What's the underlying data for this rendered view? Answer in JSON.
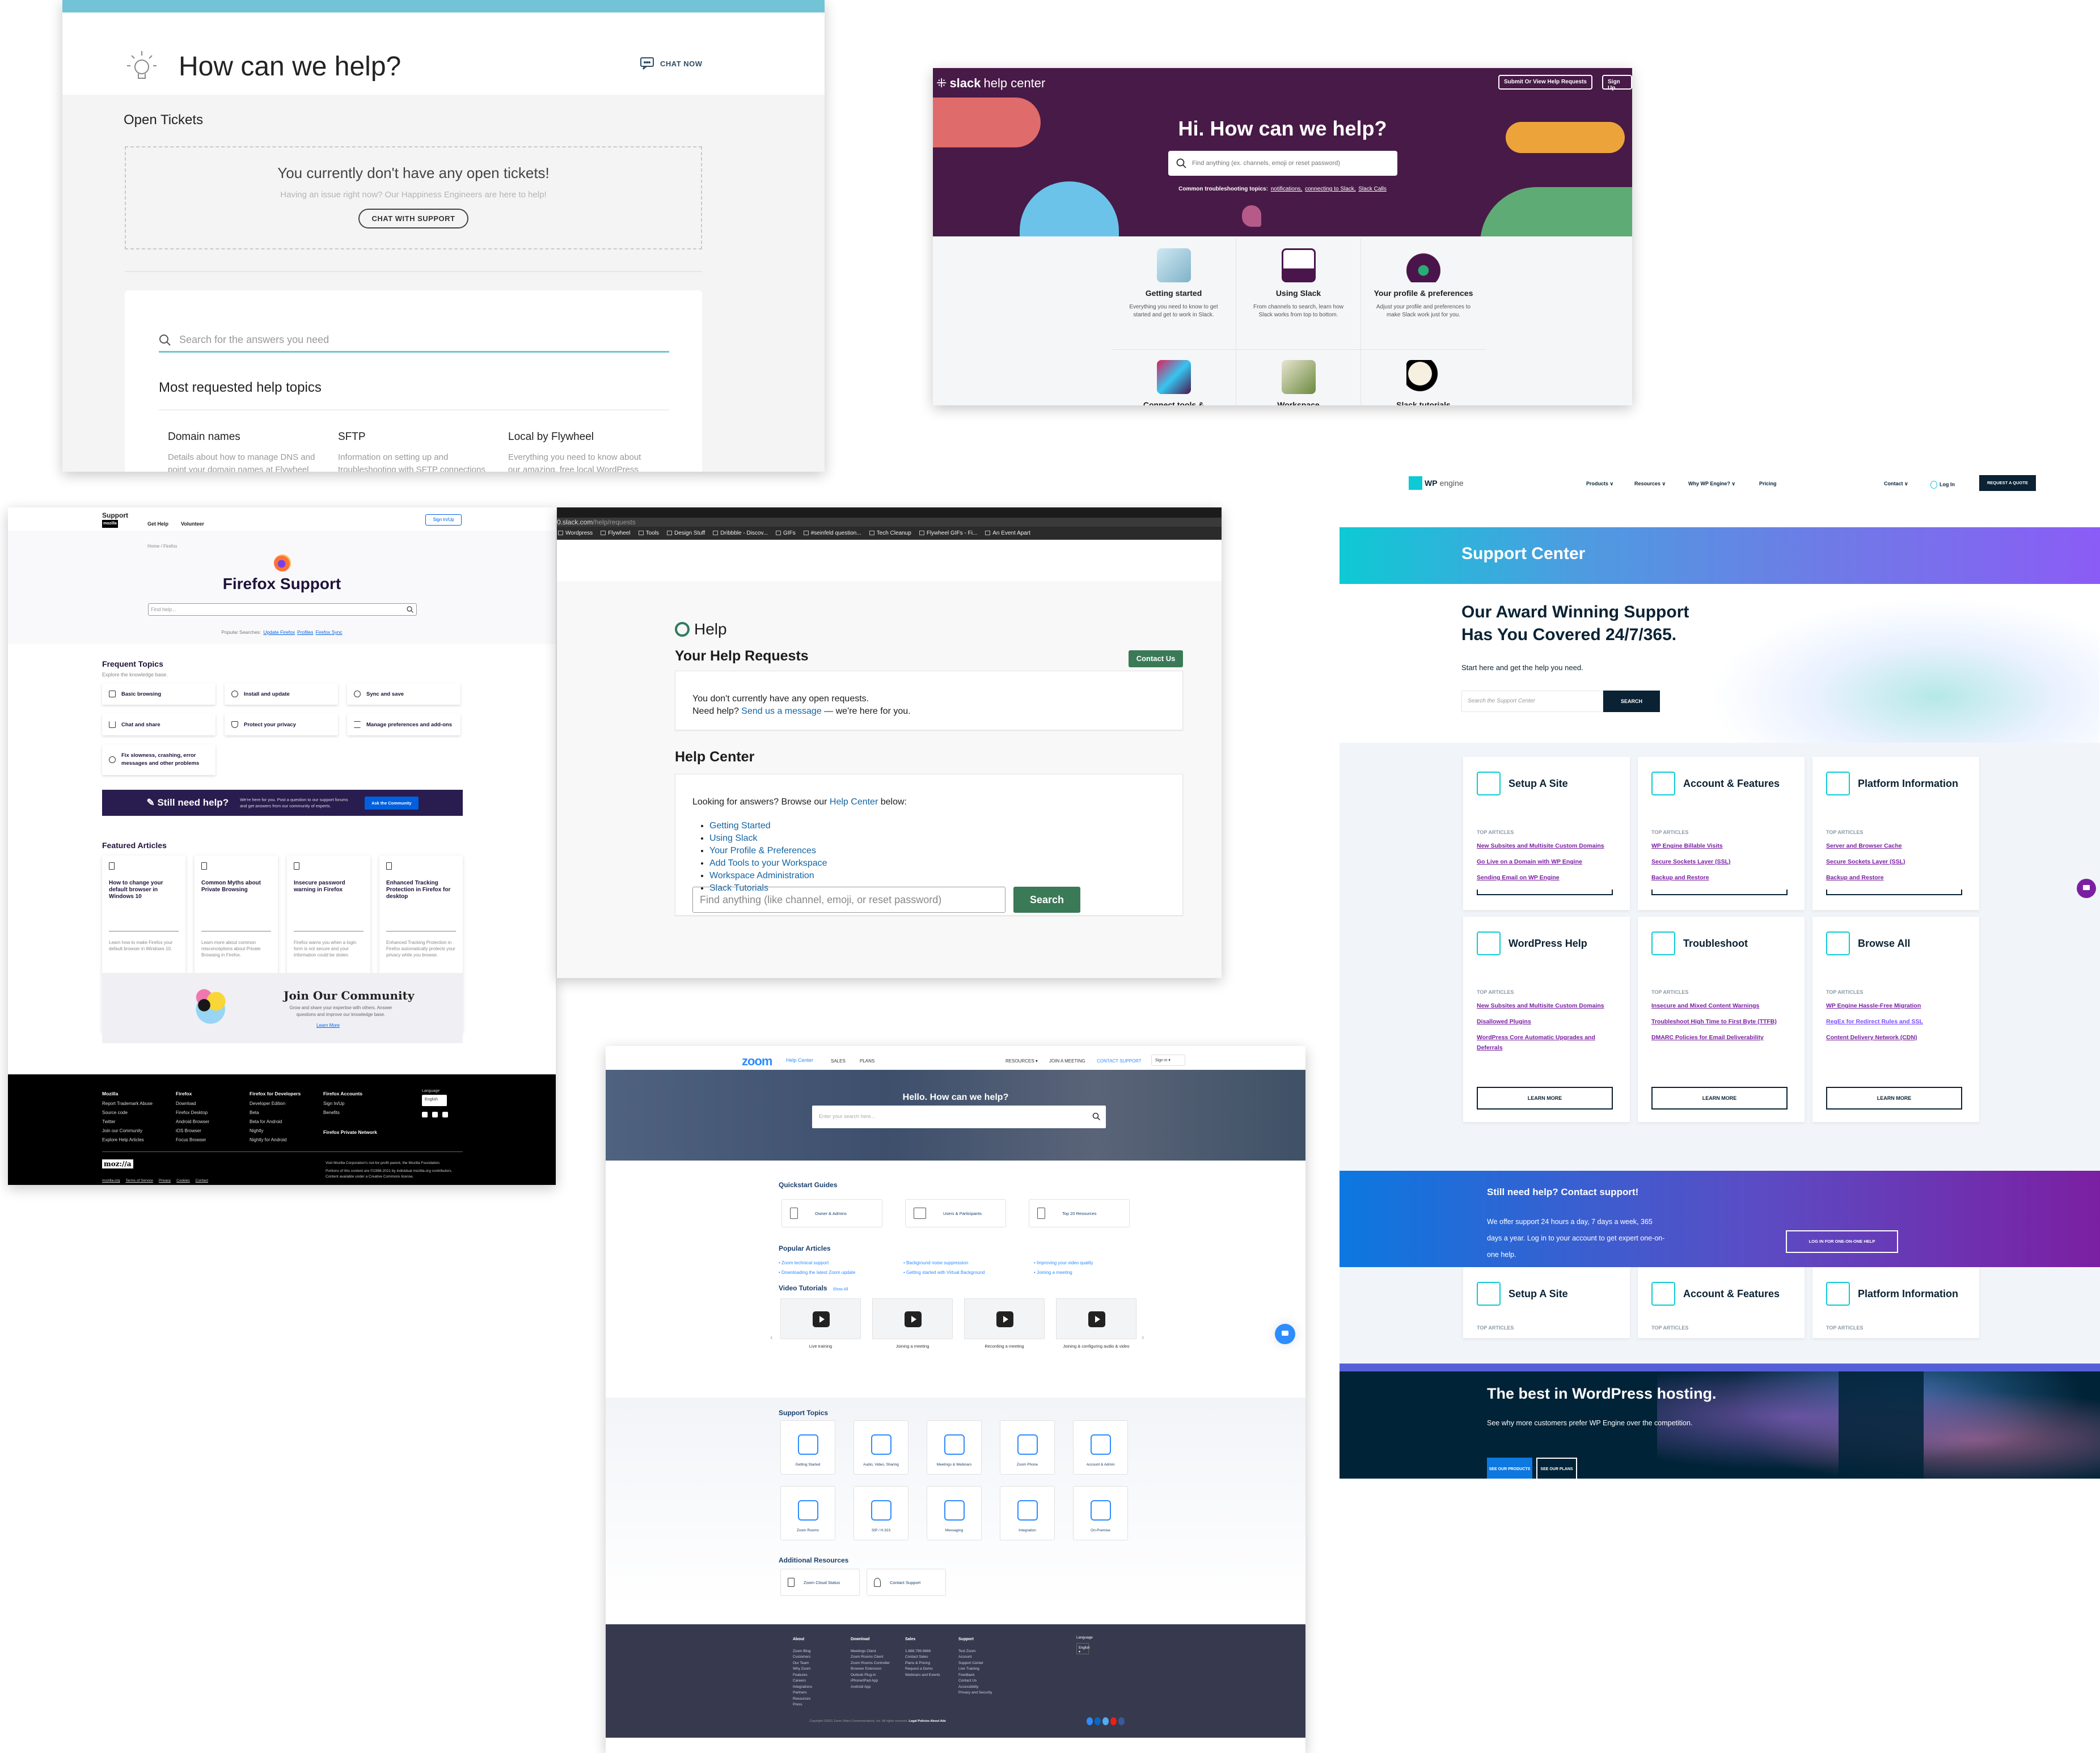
{
  "flywheel": {
    "title": "How can we help?",
    "chat_now": "CHAT NOW",
    "open_tickets_heading": "Open Tickets",
    "no_tickets": "You currently don't have any open tickets!",
    "no_tickets_sub": "Having an issue right now? Our Happiness Engineers are here to help!",
    "chat_with_support": "CHAT WITH SUPPORT",
    "search_placeholder": "Search for the answers you need",
    "most_requested": "Most requested help topics",
    "topics": [
      {
        "title": "Domain names",
        "desc": "Details about how to manage DNS and point your domain names at Flywheel"
      },
      {
        "title": "SFTP",
        "desc": "Information on setting up and troubleshooting with SFTP connections"
      },
      {
        "title": "Local by Flywheel",
        "desc": "Everything you need to know about our amazing, free local WordPress"
      }
    ]
  },
  "slack_help": {
    "logo_bold": "slack",
    "logo_rest": "help center",
    "submit_button": "Submit Or View Help Requests",
    "signup_button": "Sign Up",
    "title": "Hi. How can we help?",
    "search_placeholder": "Find anything (ex. channels, emoji or reset password)",
    "common_label": "Common troubleshooting topics:",
    "common_links": [
      "notifications,",
      "connecting to Slack,",
      "Slack Calls"
    ],
    "categories": [
      {
        "title": "Getting started",
        "desc": "Everything you need to know to get started and get to work in Slack."
      },
      {
        "title": "Using Slack",
        "desc": "From channels to search, learn how Slack works from top to bottom."
      },
      {
        "title": "Your profile & preferences",
        "desc": "Adjust your profile and preferences to make Slack work just for you."
      },
      {
        "title": "Connect tools &",
        "desc": ""
      },
      {
        "title": "Workspace",
        "desc": ""
      },
      {
        "title": "Slack tutorials",
        "desc": ""
      }
    ],
    "colors": {
      "bg": "#481a47",
      "red": "#e06b6b",
      "orange": "#eca43a",
      "blue": "#6bc3ea",
      "green": "#5fab75",
      "pink": "#b65a8a"
    }
  },
  "firefox": {
    "brand": "Support",
    "brand_sub": "mozilla",
    "nav": [
      "Get Help",
      "Volunteer"
    ],
    "sign_in": "Sign In/Up",
    "breadcrumb": "Home / Firefox",
    "title": "Firefox Support",
    "search_placeholder": "Find help...",
    "popular_label": "Popular Searches:",
    "popular_links": [
      "Update Firefox",
      "Profiles",
      "Firefox Sync"
    ],
    "frequent_heading": "Frequent Topics",
    "frequent_sub": "Explore the knowledge base.",
    "topics": [
      "Basic browsing",
      "Install and update",
      "Sync and save",
      "Chat and share",
      "Protect your privacy",
      "Manage preferences and add-ons",
      "Fix slowness, crashing, error messages and other problems"
    ],
    "still_title": "Still need help?",
    "still_desc": "We're here for you. Post a question to our support forums and get answers from our community of experts.",
    "still_button": "Ask the Community",
    "featured_heading": "Featured Articles",
    "articles": [
      {
        "title": "How to change your default browser in Windows 10",
        "desc": "Learn how to make Firefox your default browser in Windows 10."
      },
      {
        "title": "Common Myths about Private Browsing",
        "desc": "Learn more about common misconceptions about Private Browsing in Firefox."
      },
      {
        "title": "Insecure password warning in Firefox",
        "desc": "Firefox warns you when a login form is not secure and your information could be stolen."
      },
      {
        "title": "Enhanced Tracking Protection in Firefox for desktop",
        "desc": "Enhanced Tracking Protection in Firefox automatically protects your privacy while you browse."
      }
    ],
    "community_title": "Join Our Community",
    "community_desc": "Grow and share your expertise with others. Answer questions and improve our knowledge base.",
    "community_link": "Learn More",
    "footer": {
      "columns": [
        {
          "title": "Mozilla",
          "links": [
            "Report Trademark Abuse",
            "Source code",
            "Twitter",
            "Join our Community",
            "Explore Help Articles"
          ]
        },
        {
          "title": "Firefox",
          "links": [
            "Download",
            "Firefox Desktop",
            "Android Browser",
            "iOS Browser",
            "Focus Browser"
          ]
        },
        {
          "title": "Firefox for Developers",
          "links": [
            "Developer Edition",
            "Beta",
            "Beta for Android",
            "Nightly",
            "Nightly for Android"
          ]
        },
        {
          "title": "Firefox Accounts",
          "links": [
            "Sign In/Up",
            "Benefits"
          ]
        }
      ],
      "private_network": "Firefox Private Network",
      "language_label": "Language",
      "language_value": "English",
      "logo": "moz://a",
      "legal": [
        "mozilla.org",
        "Terms of Service",
        "Privacy",
        "Cookies",
        "Contact"
      ],
      "note1": "Visit Mozilla Corporation's not-for-profit parent, the Mozilla Foundation.",
      "note2": "Portions of this content are ©1998-2021 by individual mozilla.org contributors. Content available under a Creative Commons license."
    }
  },
  "slack_requests": {
    "url_host": "0.slack.com",
    "url_path": "/help/requests",
    "bookmarks": [
      "Wordpress",
      "Flywheel",
      "Tools",
      "Design Stuff",
      "Dribbble - Discov...",
      "GIFs",
      "#seinfeld question...",
      "Tech Cleanup",
      "Flywheel GIFs - Fi...",
      "An Event Apart"
    ],
    "help_title": "Help",
    "requests_heading": "Your Help Requests",
    "contact_us": "Contact Us",
    "no_requests": "You don't currently have any open requests.",
    "need_help": "Need help?",
    "send_message": "Send us a message",
    "here_for_you": "— we're here for you.",
    "help_center_heading": "Help Center",
    "looking": "Looking for answers? Browse our",
    "help_center_link": "Help Center",
    "below": "below:",
    "links": [
      "Getting Started",
      "Using Slack",
      "Your Profile & Preferences",
      "Add Tools to your Workspace",
      "Workspace Administration",
      "Slack Tutorials"
    ],
    "search_placeholder": "Find anything (like channel, emoji, or reset password)",
    "search_button": "Search"
  },
  "zoom": {
    "logo": "zoom",
    "help_center": "Help Center",
    "nav_left": [
      "SALES",
      "PLANS"
    ],
    "nav_right": [
      "RESOURCES ▾",
      "JOIN A MEETING",
      "CONTACT SUPPORT"
    ],
    "sign_in": "Sign in  ▾",
    "hero_title": "Hello. How can we help?",
    "search_placeholder": "Enter your search here...",
    "quickstart_heading": "Quickstart Guides",
    "quickstart": [
      "Owner & Admins",
      "Users & Participants",
      "Top 20 Resources"
    ],
    "popular_heading": "Popular Articles",
    "popular": [
      "Zoom technical support",
      "Background noise suppression",
      "Improving your video quality",
      "Downloading the latest Zoom update",
      "Getting started with Virtual Background",
      "Joining a meeting"
    ],
    "video_heading": "Video Tutorials",
    "show_all": "Show All",
    "videos": [
      "Live training",
      "Joining a meeting",
      "Recording a meeting",
      "Joining & configuring audio & video"
    ],
    "support_heading": "Support Topics",
    "support_topics": [
      "Getting Started",
      "Audio, Video, Sharing",
      "Meetings & Webinars",
      "Zoom Phone",
      "Account & Admin",
      "Zoom Rooms",
      "SIP / H.323",
      "Messaging",
      "Integration",
      "On-Premise"
    ],
    "additional_heading": "Additional Resources",
    "additional": [
      "Zoom Cloud Status",
      "Contact Support"
    ],
    "footer": {
      "columns": [
        {
          "title": "About",
          "links": [
            "Zoom Blog",
            "Customers",
            "Our Team",
            "Why Zoom",
            "Features",
            "Careers",
            "Integrations",
            "Partners",
            "Resources",
            "Press"
          ]
        },
        {
          "title": "Download",
          "links": [
            "Meetings Client",
            "Zoom Rooms Client",
            "Zoom Rooms Controller",
            "Browser Extension",
            "Outlook Plug-in",
            "iPhone/iPad App",
            "Android App"
          ]
        },
        {
          "title": "Sales",
          "links": [
            "1.888.799.9666",
            "Contact Sales",
            "Plans & Pricing",
            "Request a Demo",
            "Webinars and Events"
          ]
        },
        {
          "title": "Support",
          "links": [
            "Test Zoom",
            "Account",
            "Support Center",
            "Live Training",
            "Feedback",
            "Contact Us",
            "Accessibility",
            "Privacy and Security"
          ]
        }
      ],
      "language_label": "Language",
      "language_value": "English ▾",
      "copyright": "Copyright ©2021 Zoom Video Communications, Inc. All rights reserved.",
      "legal": "Legal Policies About Ads",
      "social_colors": [
        "#2d8cff",
        "#0a66c2",
        "#55acee",
        "#e62117",
        "#3b5998"
      ]
    }
  },
  "wpengine": {
    "logo_bold": "WP",
    "logo_rest": "engine",
    "nav": [
      "Products ∨",
      "Resources ∨",
      "Why WP Engine? ∨",
      "Pricing"
    ],
    "contact": "Contact ∨",
    "login": "Log In",
    "quote": "REQUEST A QUOTE",
    "band_title": "Support Center",
    "headline_1": "Our Award Winning Support",
    "headline_2": "Has You Covered 24/7/365.",
    "subline": "Start here and get the help you need.",
    "search_placeholder": "Search the Support Center",
    "search_button": "SEARCH",
    "top_articles_label": "TOP ARTICLES",
    "learn_more": "LEARN MORE",
    "cards": [
      {
        "title": "Setup A Site",
        "links": [
          "New Subsites and Multisite Custom Domains",
          "Go Live on a Domain with WP Engine",
          "Sending Email on WP Engine"
        ]
      },
      {
        "title": "Account & Features",
        "links": [
          "WP Engine Billable Visits",
          "Secure Sockets Layer (SSL)",
          "Backup and Restore"
        ]
      },
      {
        "title": "Platform Information",
        "links": [
          "Server and Browser Cache",
          "Secure Sockets Layer (SSL)",
          "Backup and Restore"
        ]
      },
      {
        "title": "WordPress Help",
        "links": [
          "New Subsites and Multisite Custom Domains",
          "Disallowed Plugins",
          "WordPress Core Automatic Upgrades and Deferrals"
        ]
      },
      {
        "title": "Troubleshoot",
        "links": [
          "Insecure and Mixed Content Warnings",
          "Troubleshoot High Time to First Byte (TTFB)",
          "DMARC Policies for Email Deliverability"
        ]
      },
      {
        "title": "Browse All",
        "links": [
          "WP Engine Hassle-Free Migration",
          "RegEx for Redirect Rules and SSL",
          "Content Delivery Network (CDN)"
        ]
      }
    ],
    "help_title": "Still need help? Contact support!",
    "help_desc": "We offer support 24 hours a day, 7 days a week, 365 days a year. Log in to your account to get expert one-on-one help.",
    "help_button": "LOG IN FOR ONE-ON-ONE HELP",
    "best_title": "The best in WordPress hosting.",
    "best_desc": "See why more customers prefer WP Engine over the competition.",
    "products_button": "SEE OUR PRODUCTS",
    "plans_button": "SEE OUR PLANS",
    "colors": {
      "navy": "#0a2233",
      "teal": "#0ecad4",
      "link": "#7b1fa2",
      "blue": "#0c78e0"
    }
  }
}
